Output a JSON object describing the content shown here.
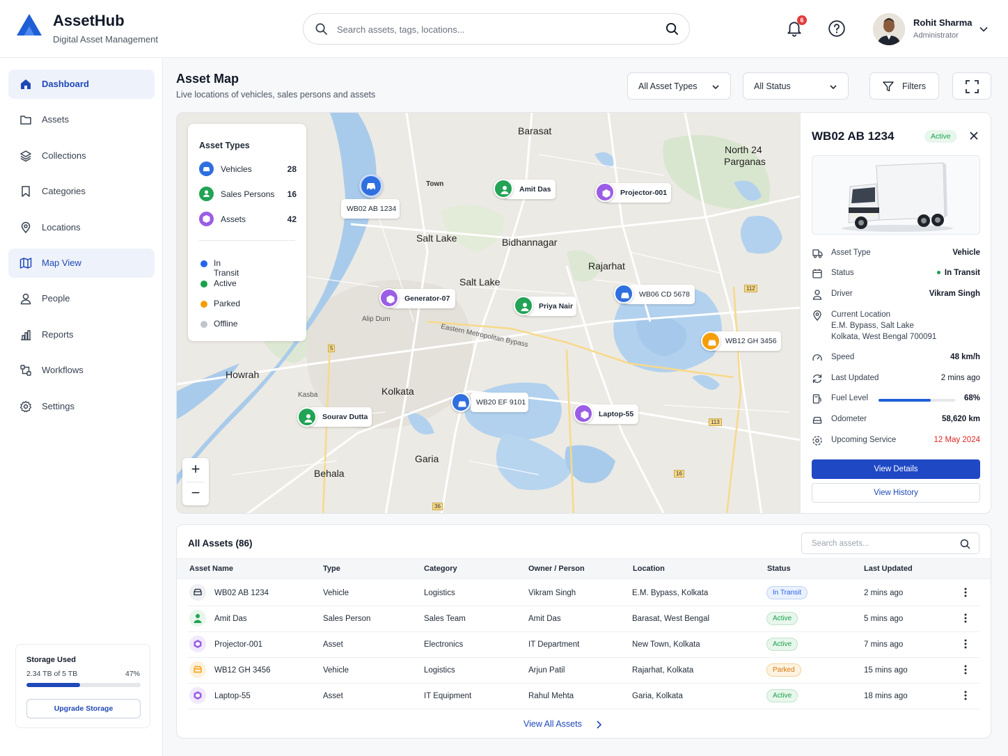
{
  "app": {
    "name": "AssetHub",
    "subtitle": "Digital Asset Management",
    "brand_color": "#1f5fd6"
  },
  "search": {
    "placeholder": "Search assets, tags, locations..."
  },
  "notifications": {
    "count": "6"
  },
  "user": {
    "name": "Rohit Sharma",
    "role": "Administrator"
  },
  "sidebar": {
    "items": [
      {
        "label": "Dashboard",
        "icon": "home-icon",
        "active": true
      },
      {
        "label": "Assets",
        "icon": "folder-icon"
      },
      {
        "label": "Collections",
        "icon": "layers-icon"
      },
      {
        "label": "Categories",
        "icon": "bookmark-icon"
      },
      {
        "label": "Locations",
        "icon": "location-pin-icon"
      },
      {
        "label": "Map View",
        "icon": "map-icon",
        "active": true
      },
      {
        "label": "People",
        "icon": "person-icon"
      },
      {
        "label": "Reports",
        "icon": "bar-chart-icon"
      },
      {
        "label": "Workflows",
        "icon": "workflow-icon"
      },
      {
        "label": "Settings",
        "icon": "gear-icon"
      }
    ],
    "storage": {
      "title": "Storage Used",
      "value": "2.34 TB of 5 TB",
      "percent": "47%",
      "fraction": 0.47,
      "button": "Upgrade Storage"
    }
  },
  "page": {
    "title": "Asset Map",
    "subtitle": "Live locations of vehicles, sales persons and assets",
    "filter_type": "All Asset Types",
    "filter_status": "All Status",
    "filters_label": "Filters"
  },
  "map": {
    "legend": {
      "title": "Asset Types",
      "types": [
        {
          "label": "Vehicles",
          "count": "28",
          "color": "#2f6fe0"
        },
        {
          "label": "Sales Persons",
          "count": "16",
          "color": "#22a355"
        },
        {
          "label": "Assets",
          "count": "42",
          "color": "#9b5de5"
        }
      ],
      "statuses": [
        {
          "label": "In Transit",
          "color": "#2563eb"
        },
        {
          "label": "Active",
          "color": "#16a34a"
        },
        {
          "label": "Parked",
          "color": "#f59e0b"
        },
        {
          "label": "Offline",
          "color": "#c0c4cc"
        }
      ]
    },
    "places": {
      "barasat": "Barasat",
      "north24": "North 24",
      "parganas": "Parganas",
      "saltlake1": "Salt Lake",
      "bidhannagar": "Bidhannagar",
      "rajarhat": "Rajarhat",
      "saltlake2": "Salt Lake",
      "howrah": "Howrah",
      "kolkata": "Kolkata",
      "garia": "Garia",
      "behala": "Behala",
      "alipdum": "Alip Dum",
      "eastern": "Eastern Metropolitan Bypass",
      "town": "Town",
      "kasba": "Kasba",
      "r112": "112",
      "r113": "113",
      "r16": "16",
      "r36": "36",
      "r5": "5"
    },
    "markers": {
      "wb02": "WB02 AB 1234",
      "amit": "Amit Das",
      "projector": "Projector-001",
      "generator": "Generator-07",
      "priya": "Priya Nair",
      "wb06": "WB06 CD 5678",
      "wb12": "WB12 GH 3456",
      "sourav": "Sourav Dutta",
      "wb20": "WB20 EF 9101",
      "laptop": "Laptop-55"
    },
    "zoom_in": "+",
    "zoom_out": "−"
  },
  "detail": {
    "title": "WB02 AB 1234",
    "badge": "Active",
    "asset_type_label": "Asset Type",
    "asset_type": "Vehicle",
    "status_label": "Status",
    "status": "In Transit",
    "driver_label": "Driver",
    "driver": "Vikram Singh",
    "location_label": "Current Location",
    "location_line1": "E.M. Bypass, Salt Lake",
    "location_line2": "Kolkata, West Bengal 700091",
    "speed_label": "Speed",
    "speed": "48 km/h",
    "updated_label": "Last Updated",
    "updated": "2 mins ago",
    "fuel_label": "Fuel Level",
    "fuel": "68%",
    "fuel_fraction": 0.68,
    "odometer_label": "Odometer",
    "odometer": "58,620 km",
    "service_label": "Upcoming Service",
    "service": "12 May 2024",
    "view_details": "View Details",
    "view_history": "View History"
  },
  "table": {
    "title": "All Assets (86)",
    "search_placeholder": "Search assets...",
    "columns": [
      "Asset Name",
      "Type",
      "Category",
      "Owner / Person",
      "Location",
      "Status",
      "Last Updated"
    ],
    "rows": [
      {
        "name": "WB02 AB 1234",
        "type": "Vehicle",
        "category": "Logistics",
        "owner": "Vikram Singh",
        "location": "E.M. Bypass, Kolkata",
        "status": "In Transit",
        "updated": "2 mins ago",
        "icon": "truck-icon"
      },
      {
        "name": "Amit Das",
        "type": "Sales Person",
        "category": "Sales Team",
        "owner": "Amit Das",
        "location": "Barasat, West Bengal",
        "status": "Active",
        "updated": "5 mins ago",
        "icon": "person-icon"
      },
      {
        "name": "Projector-001",
        "type": "Asset",
        "category": "Electronics",
        "owner": "IT Department",
        "location": "New Town, Kolkata",
        "status": "Active",
        "updated": "7 mins ago",
        "icon": "box-icon"
      },
      {
        "name": "WB12 GH 3456",
        "type": "Vehicle",
        "category": "Logistics",
        "owner": "Arjun Patil",
        "location": "Rajarhat, Kolkata",
        "status": "Parked",
        "updated": "15 mins ago",
        "icon": "car-icon"
      },
      {
        "name": "Laptop-55",
        "type": "Asset",
        "category": "IT Equipment",
        "owner": "Rahul Mehta",
        "location": "Garia, Kolkata",
        "status": "Active",
        "updated": "18 mins ago",
        "icon": "box-icon"
      }
    ],
    "view_all": "View All Assets"
  }
}
